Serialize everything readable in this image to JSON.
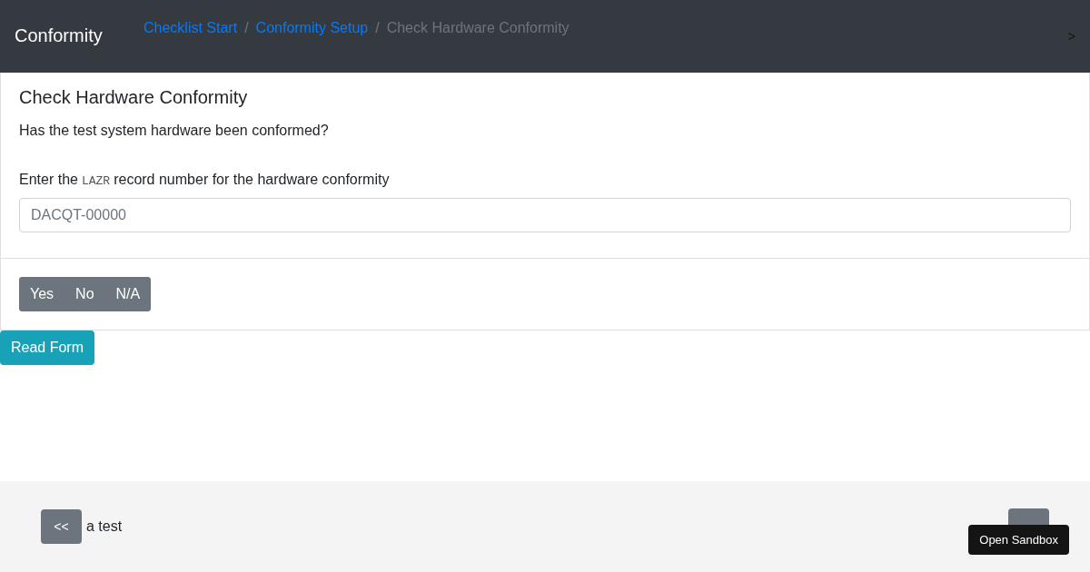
{
  "navbar": {
    "brand": "Conformity",
    "breadcrumbs": [
      {
        "label": "Checklist Start",
        "active": false
      },
      {
        "label": "Conformity Setup",
        "active": false
      },
      {
        "label": "Check Hardware Conformity",
        "active": true
      }
    ],
    "separator": "/",
    "toggle": ">"
  },
  "card": {
    "title": "Check Hardware Conformity",
    "question": "Has the test system hardware been conformed?",
    "field_label": [
      {
        "kind": "text",
        "text": "Enter the"
      },
      {
        "kind": "code",
        "text": "LAZR"
      },
      {
        "kind": "text",
        "text": "record number for the hardware conformity"
      }
    ],
    "field": {
      "placeholder": "DACQT-00000"
    },
    "choices": [
      {
        "label": "Yes",
        "selected": false
      },
      {
        "label": "No",
        "selected": false
      },
      {
        "label": "N/A",
        "selected": false
      }
    ]
  },
  "read_form_button": "Read Form",
  "footer": {
    "prev_button": "<<",
    "prev_label": "a test",
    "tooltip": "Open Sandbox"
  }
}
